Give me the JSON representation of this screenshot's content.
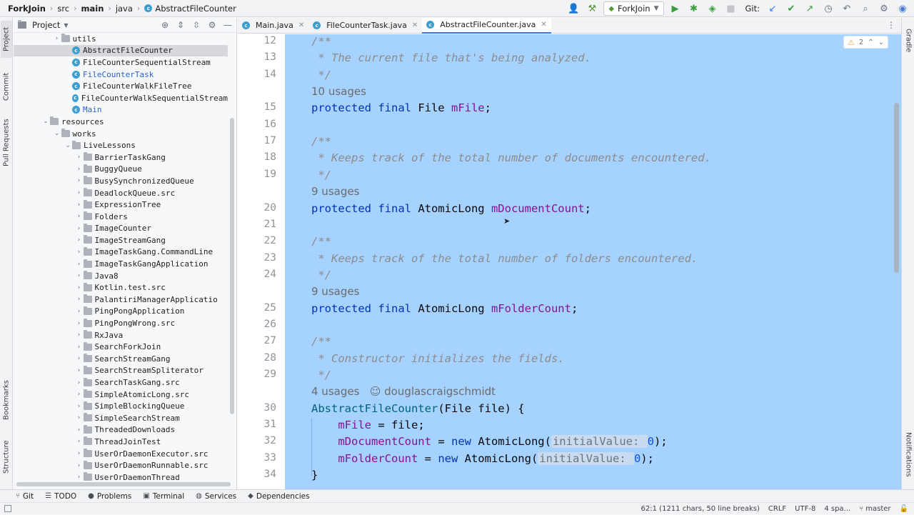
{
  "navbar": {
    "project": "ForkJoin",
    "breadcrumbs": [
      "src",
      "main",
      "java",
      "AbstractFileCounter"
    ],
    "run_config": "ForkJoin",
    "git_label": "Git:"
  },
  "left_stripe": {
    "tabs": [
      "Project",
      "Commit",
      "Pull Requests",
      "Bookmarks",
      "Structure"
    ]
  },
  "right_stripe": {
    "tabs": [
      "Gradle",
      "Notifications"
    ]
  },
  "project_panel": {
    "title": "Project",
    "items": [
      {
        "label": "utils",
        "kind": "folder",
        "depth": 4,
        "arrow": "right"
      },
      {
        "label": "AbstractFileCounter",
        "kind": "class",
        "depth": 5,
        "selected": true
      },
      {
        "label": "FileCounterSequentialStream",
        "kind": "class",
        "depth": 5
      },
      {
        "label": "FileCounterTask",
        "kind": "class",
        "depth": 5,
        "blue": true
      },
      {
        "label": "FileCounterWalkFileTree",
        "kind": "class",
        "depth": 5
      },
      {
        "label": "FileCounterWalkSequentialStream",
        "kind": "class",
        "depth": 5
      },
      {
        "label": "Main",
        "kind": "class",
        "depth": 5,
        "blue": true
      },
      {
        "label": "resources",
        "kind": "folder",
        "depth": 3,
        "arrow": "down"
      },
      {
        "label": "works",
        "kind": "folder",
        "depth": 4,
        "arrow": "down"
      },
      {
        "label": "LiveLessons",
        "kind": "folder",
        "depth": 5,
        "arrow": "down"
      },
      {
        "label": "BarrierTaskGang",
        "kind": "folder",
        "depth": 6,
        "arrow": "right"
      },
      {
        "label": "BuggyQueue",
        "kind": "folder",
        "depth": 6,
        "arrow": "right"
      },
      {
        "label": "BusySynchronizedQueue",
        "kind": "folder",
        "depth": 6,
        "arrow": "right"
      },
      {
        "label": "DeadlockQueue.src",
        "kind": "folder",
        "depth": 6,
        "arrow": "right"
      },
      {
        "label": "ExpressionTree",
        "kind": "folder",
        "depth": 6,
        "arrow": "right"
      },
      {
        "label": "Folders",
        "kind": "folder",
        "depth": 6,
        "arrow": "right"
      },
      {
        "label": "ImageCounter",
        "kind": "folder",
        "depth": 6,
        "arrow": "right"
      },
      {
        "label": "ImageStreamGang",
        "kind": "folder",
        "depth": 6,
        "arrow": "right"
      },
      {
        "label": "ImageTaskGang.CommandLine",
        "kind": "folder",
        "depth": 6,
        "arrow": "right"
      },
      {
        "label": "ImageTaskGangApplication",
        "kind": "folder",
        "depth": 6,
        "arrow": "right"
      },
      {
        "label": "Java8",
        "kind": "folder",
        "depth": 6,
        "arrow": "right"
      },
      {
        "label": "Kotlin.test.src",
        "kind": "folder",
        "depth": 6,
        "arrow": "right"
      },
      {
        "label": "PalantiriManagerApplicatio",
        "kind": "folder",
        "depth": 6,
        "arrow": "right"
      },
      {
        "label": "PingPongApplication",
        "kind": "folder",
        "depth": 6,
        "arrow": "right"
      },
      {
        "label": "PingPongWrong.src",
        "kind": "folder",
        "depth": 6,
        "arrow": "right"
      },
      {
        "label": "RxJava",
        "kind": "folder",
        "depth": 6,
        "arrow": "right"
      },
      {
        "label": "SearchForkJoin",
        "kind": "folder",
        "depth": 6,
        "arrow": "right"
      },
      {
        "label": "SearchStreamGang",
        "kind": "folder",
        "depth": 6,
        "arrow": "right"
      },
      {
        "label": "SearchStreamSpliterator",
        "kind": "folder",
        "depth": 6,
        "arrow": "right"
      },
      {
        "label": "SearchTaskGang.src",
        "kind": "folder",
        "depth": 6,
        "arrow": "right"
      },
      {
        "label": "SimpleAtomicLong.src",
        "kind": "folder",
        "depth": 6,
        "arrow": "right"
      },
      {
        "label": "SimpleBlockingQueue",
        "kind": "folder",
        "depth": 6,
        "arrow": "right"
      },
      {
        "label": "SimpleSearchStream",
        "kind": "folder",
        "depth": 6,
        "arrow": "right"
      },
      {
        "label": "ThreadedDownloads",
        "kind": "folder",
        "depth": 6,
        "arrow": "right"
      },
      {
        "label": "ThreadJoinTest",
        "kind": "folder",
        "depth": 6,
        "arrow": "right"
      },
      {
        "label": "UserOrDaemonExecutor.src",
        "kind": "folder",
        "depth": 6,
        "arrow": "right"
      },
      {
        "label": "UserOrDaemonRunnable.src",
        "kind": "folder",
        "depth": 6,
        "arrow": "right"
      },
      {
        "label": "UserOrDaemonThread",
        "kind": "folder",
        "depth": 6,
        "arrow": "right"
      }
    ]
  },
  "editor_tabs": [
    {
      "label": "Main.java",
      "active": false
    },
    {
      "label": "FileCounterTask.java",
      "active": false
    },
    {
      "label": "AbstractFileCounter.java",
      "active": true
    }
  ],
  "inspection": {
    "warnings": "2"
  },
  "code": {
    "lines": [
      {
        "num": "12",
        "segments": [
          {
            "t": "/**",
            "c": "cmt"
          }
        ]
      },
      {
        "num": "13",
        "segments": [
          {
            "t": " * The current file that's being analyzed.",
            "c": "cmt"
          }
        ]
      },
      {
        "num": "14",
        "segments": [
          {
            "t": " */",
            "c": "cmt"
          }
        ]
      },
      {
        "num": "",
        "segments": [
          {
            "t": "10 usages",
            "c": "ann"
          }
        ]
      },
      {
        "num": "15",
        "segments": [
          {
            "t": "protected final ",
            "c": "kw"
          },
          {
            "t": "File ",
            "c": ""
          },
          {
            "t": "mFile",
            "c": "fld"
          },
          {
            "t": ";",
            "c": ""
          }
        ]
      },
      {
        "num": "16",
        "segments": []
      },
      {
        "num": "17",
        "segments": [
          {
            "t": "/**",
            "c": "cmt"
          }
        ]
      },
      {
        "num": "18",
        "segments": [
          {
            "t": " * Keeps track of the total number of documents encountered.",
            "c": "cmt"
          }
        ]
      },
      {
        "num": "19",
        "segments": [
          {
            "t": " */",
            "c": "cmt"
          }
        ]
      },
      {
        "num": "",
        "segments": [
          {
            "t": "9 usages",
            "c": "ann"
          }
        ]
      },
      {
        "num": "20",
        "segments": [
          {
            "t": "protected final ",
            "c": "kw"
          },
          {
            "t": "AtomicLong ",
            "c": ""
          },
          {
            "t": "mDocumentCount",
            "c": "fld"
          },
          {
            "t": ";",
            "c": ""
          }
        ]
      },
      {
        "num": "21",
        "segments": []
      },
      {
        "num": "22",
        "segments": [
          {
            "t": "/**",
            "c": "cmt"
          }
        ]
      },
      {
        "num": "23",
        "segments": [
          {
            "t": " * Keeps track of the total number of folders encountered.",
            "c": "cmt"
          }
        ]
      },
      {
        "num": "24",
        "segments": [
          {
            "t": " */",
            "c": "cmt"
          }
        ]
      },
      {
        "num": "",
        "segments": [
          {
            "t": "9 usages",
            "c": "ann"
          }
        ]
      },
      {
        "num": "25",
        "segments": [
          {
            "t": "protected final ",
            "c": "kw"
          },
          {
            "t": "AtomicLong ",
            "c": ""
          },
          {
            "t": "mFolderCount",
            "c": "fld"
          },
          {
            "t": ";",
            "c": ""
          }
        ]
      },
      {
        "num": "26",
        "segments": []
      },
      {
        "num": "27",
        "segments": [
          {
            "t": "/**",
            "c": "cmt"
          }
        ]
      },
      {
        "num": "28",
        "segments": [
          {
            "t": " * Constructor initializes the fields.",
            "c": "cmt"
          }
        ]
      },
      {
        "num": "29",
        "segments": [
          {
            "t": " */",
            "c": "cmt"
          }
        ]
      },
      {
        "num": "",
        "segments": [
          {
            "t": "4 usages   ☺ douglascraigschmidt",
            "c": "ann"
          }
        ]
      },
      {
        "num": "30",
        "segments": [
          {
            "t": "AbstractFileCounter",
            "c": "mfn"
          },
          {
            "t": "(File file) {",
            "c": ""
          }
        ]
      },
      {
        "num": "31",
        "segments": [
          {
            "t": "    ",
            "c": ""
          },
          {
            "t": "mFile",
            "c": "fld"
          },
          {
            "t": " = file;",
            "c": ""
          }
        ]
      },
      {
        "num": "32",
        "segments": [
          {
            "t": "    ",
            "c": ""
          },
          {
            "t": "mDocumentCount",
            "c": "fld"
          },
          {
            "t": " = ",
            "c": ""
          },
          {
            "t": "new ",
            "c": "kw"
          },
          {
            "t": "AtomicLong(",
            "c": ""
          },
          {
            "t": "initialValue: ",
            "c": "hint"
          },
          {
            "t": "0",
            "c": "num"
          },
          {
            "t": ");",
            "c": ""
          }
        ]
      },
      {
        "num": "33",
        "segments": [
          {
            "t": "    ",
            "c": ""
          },
          {
            "t": "mFolderCount",
            "c": "fld"
          },
          {
            "t": " = ",
            "c": ""
          },
          {
            "t": "new ",
            "c": "kw"
          },
          {
            "t": "AtomicLong(",
            "c": ""
          },
          {
            "t": "initialValue: ",
            "c": "hint"
          },
          {
            "t": "0",
            "c": "num"
          },
          {
            "t": ");",
            "c": ""
          }
        ]
      },
      {
        "num": "34",
        "segments": [
          {
            "t": "}",
            "c": ""
          }
        ]
      }
    ]
  },
  "bottom_tools": [
    "Git",
    "TODO",
    "Problems",
    "Terminal",
    "Services",
    "Dependencies"
  ],
  "status": {
    "position": "62:1 (1211 chars, 50 line breaks)",
    "line_sep": "CRLF",
    "encoding": "UTF-8",
    "indent": "4 spa...",
    "branch": "master"
  }
}
